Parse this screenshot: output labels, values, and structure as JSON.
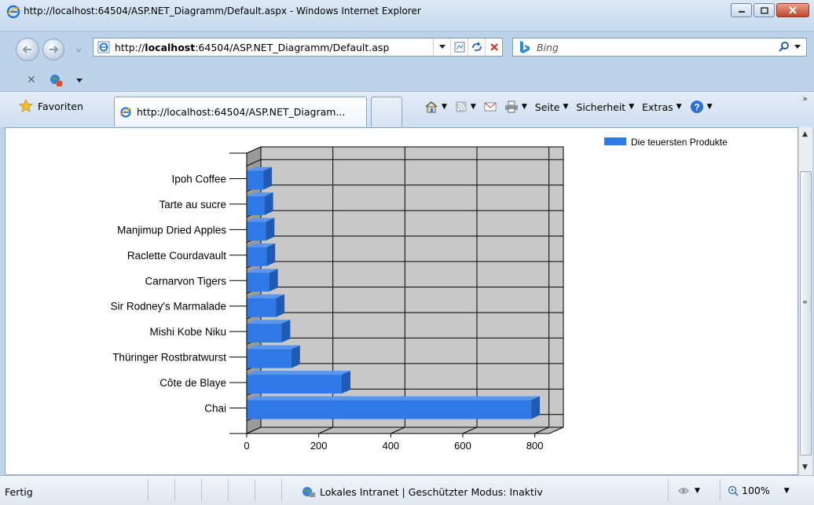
{
  "window": {
    "title": "http://localhost:64504/ASP.NET_Diagramm/Default.aspx - Windows Internet Explorer"
  },
  "address": {
    "url_prefix": "http://",
    "url_host": "localhost",
    "url_rest": ":64504/ASP.NET_Diagramm/Default.asp"
  },
  "search": {
    "placeholder": "Bing"
  },
  "favorites": {
    "label": "Favoriten"
  },
  "tab": {
    "title": "http://localhost:64504/ASP.NET_Diagram..."
  },
  "commandbar": {
    "page": "Seite",
    "safety": "Sicherheit",
    "extras": "Extras"
  },
  "status": {
    "text": "Fertig",
    "zone": "Lokales Intranet | Geschützter Modus: Inaktiv",
    "zoom": "100%"
  },
  "colors": {
    "bar_front": "#2f79e6",
    "bar_top": "#5a96ee",
    "bar_side": "#1f5bb5",
    "plot_bg": "#c8c8c8",
    "wall": "#9a9a9a"
  },
  "icons": [
    "ie-logo-icon",
    "back-icon",
    "forward-icon",
    "refresh-icon",
    "stop-icon",
    "bing-icon",
    "search-icon",
    "favorites-star-icon",
    "home-icon",
    "feeds-icon",
    "mail-icon",
    "print-icon",
    "help-icon",
    "intranet-icon",
    "zoom-icon"
  ],
  "chart_data": {
    "type": "bar",
    "orientation": "horizontal",
    "categories": [
      "Chai",
      "Côte de Blaye",
      "Thüringer Rostbratwurst",
      "Mishi Kobe Niku",
      "Sir Rodney's Marmalade",
      "Carnarvon Tigers",
      "Raclette Courdavault",
      "Manjimup Dried Apples",
      "Tarte au sucre",
      "Ipoh Coffee"
    ],
    "series": [
      {
        "name": "Die teuersten Produkte",
        "values": [
          790,
          264,
          124,
          97,
          81,
          62.5,
          55,
          53,
          49.3,
          46
        ]
      }
    ],
    "xticks": [
      0,
      200,
      400,
      600,
      800
    ],
    "xlim": [
      0,
      840
    ],
    "grid": true,
    "legend_position": "top-right",
    "three_d": true
  }
}
